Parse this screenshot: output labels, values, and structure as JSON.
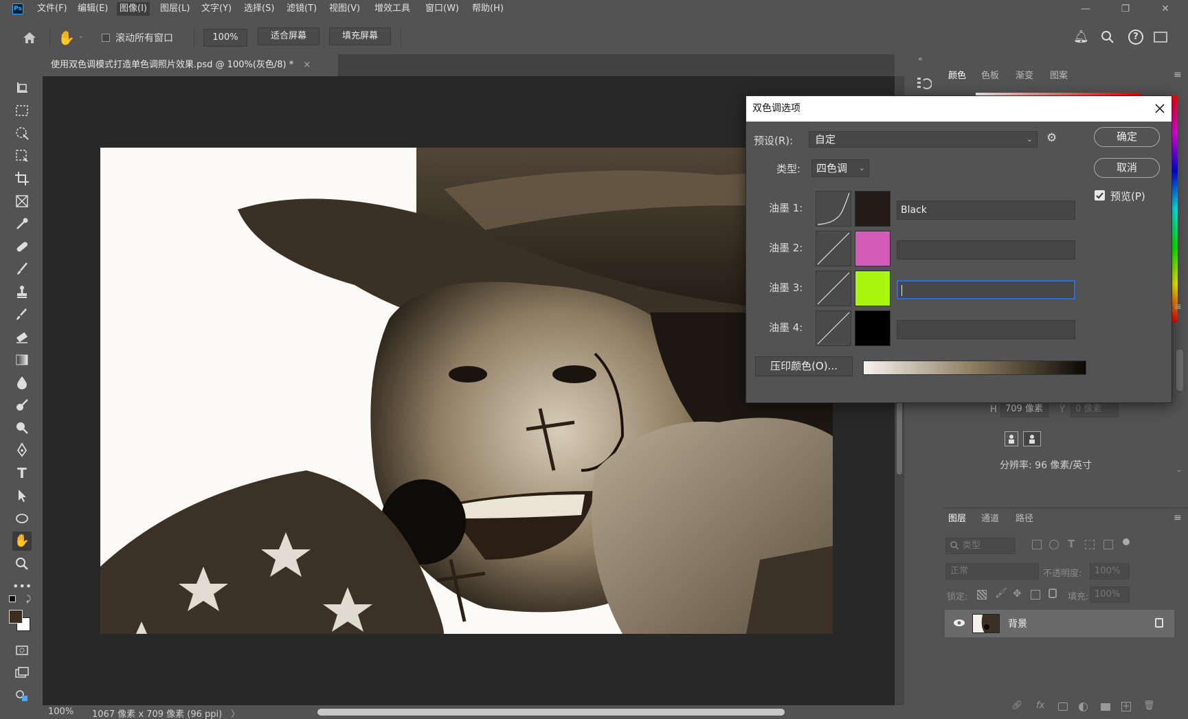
{
  "app": {
    "logo": "Ps"
  },
  "menu": [
    "文件(F)",
    "编辑(E)",
    "图像(I)",
    "图层(L)",
    "文字(Y)",
    "选择(S)",
    "滤镜(T)",
    "视图(V)",
    "增效工具",
    "窗口(W)",
    "帮助(H)"
  ],
  "window_controls": {
    "minimize": "—",
    "restore": "❐",
    "close": "✕"
  },
  "options_bar": {
    "scroll_all_label": "滚动所有窗口",
    "zoom_value": "100%",
    "fit_screen": "适合屏幕",
    "fill_screen": "填充屏幕"
  },
  "document": {
    "tab_title": "使用双色调模式打造单色调照片效果.psd @ 100%(灰色/8) *",
    "close": "×"
  },
  "status": {
    "zoom": "100%",
    "info": "1067 像素 x 709 像素 (96 ppi)",
    "arrow": "〉"
  },
  "color_panel": {
    "tabs": [
      "颜色",
      "色板",
      "渐变",
      "图案"
    ]
  },
  "properties_panel": {
    "h_label": "H",
    "h_value": "709 像素",
    "y_label": "Y",
    "y_value": "0 像素",
    "resolution": "分辨率: 96 像素/英寸"
  },
  "layers_panel": {
    "tabs": [
      "图层",
      "通道",
      "路径"
    ],
    "filter_placeholder": "类型",
    "blend_mode": "正常",
    "opacity_label": "不透明度:",
    "opacity_value": "100%",
    "lock_label": "锁定:",
    "fill_label": "填充:",
    "fill_value": "100%",
    "layer_name": "背景"
  },
  "dialog": {
    "title": "双色调选项",
    "preset_label": "预设(R):",
    "preset_value": "自定",
    "type_label": "类型:",
    "type_value": "四色调",
    "ok": "确定",
    "cancel": "取消",
    "preview_label": "预览(P)",
    "preview_checked": true,
    "overprint": "压印颜色(O)...",
    "inks": [
      {
        "label": "油墨 1:",
        "color": "#241a17",
        "name": "Black"
      },
      {
        "label": "油墨 2:",
        "color": "#d25cb8",
        "name": ""
      },
      {
        "label": "油墨 3:",
        "color": "#a9f60f",
        "name": ""
      },
      {
        "label": "油墨 4:",
        "color": "#000000",
        "name": ""
      }
    ],
    "gradient": {
      "start": "#f6f3ee",
      "mid": "#8a7b5e",
      "end": "#0a0805"
    }
  }
}
